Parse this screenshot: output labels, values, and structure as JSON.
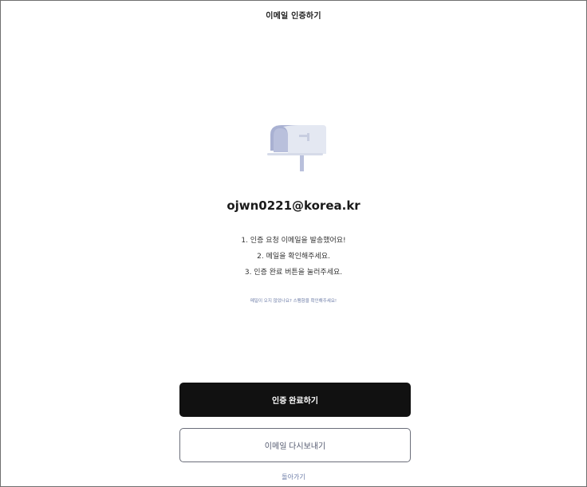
{
  "header": {
    "title": "이메일 인증하기"
  },
  "illustration": {
    "icon": "mailbox-icon",
    "colors": {
      "body_light": "#e4e8f2",
      "body_dark": "#a9b1d2",
      "flag": "#c7cde0"
    }
  },
  "main": {
    "email": "ojwn0221@korea.kr",
    "instructions": [
      "1. 인증 요청 이메일을 발송했어요!",
      "2. 메일을 확인해주세요.",
      "3. 인증 완료 버튼을 눌러주세요."
    ],
    "help_link": "메일이 오지 않았나요? 스팸함을 확인해주세요!"
  },
  "actions": {
    "complete_label": "인증 완료하기",
    "resend_label": "이메일 다시보내기",
    "back_label": "돌아가기"
  },
  "colors": {
    "primary_button": "#111111",
    "link": "#6a7aa6",
    "border": "#6b6e7a"
  }
}
